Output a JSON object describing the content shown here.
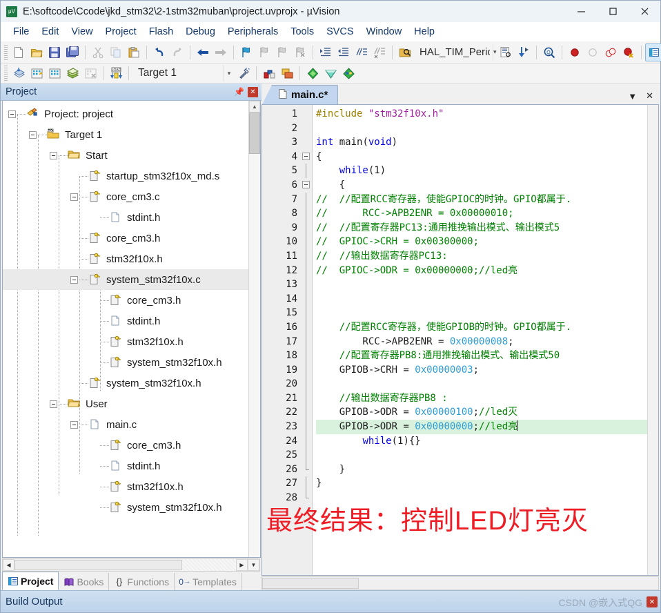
{
  "window": {
    "title": "E:\\softcode\\Ccode\\jkd_stm32\\2-1stm32muban\\project.uvprojx - µVision",
    "app_icon": "uvision-icon",
    "minimize": "—",
    "maximize": "☐",
    "close": "✕"
  },
  "menu": {
    "items": [
      {
        "label": "File"
      },
      {
        "label": "Edit"
      },
      {
        "label": "View"
      },
      {
        "label": "Project"
      },
      {
        "label": "Flash"
      },
      {
        "label": "Debug"
      },
      {
        "label": "Peripherals"
      },
      {
        "label": "Tools"
      },
      {
        "label": "SVCS"
      },
      {
        "label": "Window"
      },
      {
        "label": "Help"
      }
    ]
  },
  "toolbar2": {
    "target_value": "Target 1",
    "function_value": "HAL_TIM_PeriodE"
  },
  "project_panel": {
    "title": "Project",
    "pin_tooltip": "Auto Hide",
    "close_tooltip": "Close",
    "tree": [
      {
        "label": "Project: project",
        "depth": 0,
        "icon": "project-icon",
        "expander": "minus",
        "selected": false
      },
      {
        "label": "Target 1",
        "depth": 1,
        "icon": "target-icon",
        "expander": "minus",
        "selected": false
      },
      {
        "label": "Start",
        "depth": 2,
        "icon": "folder-icon",
        "expander": "minus",
        "selected": false
      },
      {
        "label": "startup_stm32f10x_md.s",
        "depth": 3,
        "icon": "source-file-icon",
        "expander": "none",
        "selected": false
      },
      {
        "label": "core_cm3.c",
        "depth": 3,
        "icon": "source-file-icon",
        "expander": "minus",
        "selected": false
      },
      {
        "label": "stdint.h",
        "depth": 4,
        "icon": "plain-file-icon",
        "expander": "none",
        "selected": false
      },
      {
        "label": "core_cm3.h",
        "depth": 3,
        "icon": "source-file-icon",
        "expander": "none",
        "selected": false
      },
      {
        "label": "stm32f10x.h",
        "depth": 3,
        "icon": "source-file-icon",
        "expander": "none",
        "selected": false
      },
      {
        "label": "system_stm32f10x.c",
        "depth": 3,
        "icon": "source-file-icon",
        "expander": "minus",
        "selected": true
      },
      {
        "label": "core_cm3.h",
        "depth": 4,
        "icon": "source-file-icon",
        "expander": "none",
        "selected": false
      },
      {
        "label": "stdint.h",
        "depth": 4,
        "icon": "plain-file-icon",
        "expander": "none",
        "selected": false
      },
      {
        "label": "stm32f10x.h",
        "depth": 4,
        "icon": "source-file-icon",
        "expander": "none",
        "selected": false
      },
      {
        "label": "system_stm32f10x.h",
        "depth": 4,
        "icon": "source-file-icon",
        "expander": "none",
        "selected": false
      },
      {
        "label": "system_stm32f10x.h",
        "depth": 3,
        "icon": "source-file-icon",
        "expander": "none",
        "selected": false
      },
      {
        "label": "User",
        "depth": 2,
        "icon": "folder-icon",
        "expander": "minus",
        "selected": false
      },
      {
        "label": "main.c",
        "depth": 3,
        "icon": "plain-file-icon",
        "expander": "minus",
        "selected": false
      },
      {
        "label": "core_cm3.h",
        "depth": 4,
        "icon": "source-file-icon",
        "expander": "none",
        "selected": false
      },
      {
        "label": "stdint.h",
        "depth": 4,
        "icon": "plain-file-icon",
        "expander": "none",
        "selected": false
      },
      {
        "label": "stm32f10x.h",
        "depth": 4,
        "icon": "source-file-icon",
        "expander": "none",
        "selected": false
      },
      {
        "label": "system_stm32f10x.h",
        "depth": 4,
        "icon": "source-file-icon",
        "expander": "none",
        "selected": false
      }
    ],
    "bottom_tabs": [
      {
        "label": "Project",
        "icon": "project-tab-icon",
        "active": true
      },
      {
        "label": "Books",
        "icon": "books-tab-icon",
        "active": false
      },
      {
        "label": "Functions",
        "icon": "functions-tab-icon",
        "active": false
      },
      {
        "label": "Templates",
        "icon": "templates-tab-icon",
        "active": false
      }
    ]
  },
  "editor": {
    "tab_label": "main.c*",
    "tab_icon": "file-icon",
    "dropdown_icon": "▼",
    "close_icon": "✕",
    "first_line": 1,
    "last_line": 28,
    "highlight_line": 23,
    "lines": [
      {
        "n": 1,
        "fold": "none",
        "tokens": [
          {
            "t": "#include ",
            "c": "pre"
          },
          {
            "t": "\"stm32f10x.h\"",
            "c": "str"
          }
        ]
      },
      {
        "n": 2,
        "fold": "none",
        "tokens": []
      },
      {
        "n": 3,
        "fold": "none",
        "tokens": [
          {
            "t": "int",
            "c": "kw"
          },
          {
            "t": " main(",
            "c": "plain"
          },
          {
            "t": "void",
            "c": "kw"
          },
          {
            "t": ")",
            "c": "plain"
          }
        ]
      },
      {
        "n": 4,
        "fold": "open",
        "tokens": [
          {
            "t": "{",
            "c": "plain"
          }
        ]
      },
      {
        "n": 5,
        "fold": "bar",
        "tokens": [
          {
            "t": "    ",
            "c": "plain"
          },
          {
            "t": "while",
            "c": "kw"
          },
          {
            "t": "(1)",
            "c": "plain"
          }
        ]
      },
      {
        "n": 6,
        "fold": "open2",
        "tokens": [
          {
            "t": "    {",
            "c": "plain"
          }
        ]
      },
      {
        "n": 7,
        "fold": "bar",
        "tokens": [
          {
            "t": "//  //配置RCC寄存器，使能GPIOC的时钟。GPIO都属于.",
            "c": "cmt"
          }
        ]
      },
      {
        "n": 8,
        "fold": "bar",
        "tokens": [
          {
            "t": "//      RCC->APB2ENR = 0x00000010;",
            "c": "cmt"
          }
        ]
      },
      {
        "n": 9,
        "fold": "bar",
        "tokens": [
          {
            "t": "//  //配置寄存器PC13:通用推挽输出模式、输出模式5",
            "c": "cmt"
          }
        ]
      },
      {
        "n": 10,
        "fold": "bar",
        "tokens": [
          {
            "t": "//  GPIOC->CRH = 0x00300000;",
            "c": "cmt"
          }
        ]
      },
      {
        "n": 11,
        "fold": "bar",
        "tokens": [
          {
            "t": "//  //输出数据寄存器PC13:",
            "c": "cmt"
          }
        ]
      },
      {
        "n": 12,
        "fold": "bar",
        "tokens": [
          {
            "t": "//  GPIOC->ODR = 0x00000000;//led亮",
            "c": "cmt"
          }
        ]
      },
      {
        "n": 13,
        "fold": "bar",
        "tokens": []
      },
      {
        "n": 14,
        "fold": "bar",
        "tokens": []
      },
      {
        "n": 15,
        "fold": "bar",
        "tokens": []
      },
      {
        "n": 16,
        "fold": "bar",
        "tokens": [
          {
            "t": "    //配置RCC寄存器，使能GPIOB的时钟。GPIO都属于.",
            "c": "cmt"
          }
        ]
      },
      {
        "n": 17,
        "fold": "bar",
        "tokens": [
          {
            "t": "        RCC->APB2ENR = ",
            "c": "plain"
          },
          {
            "t": "0x00000008",
            "c": "num"
          },
          {
            "t": ";",
            "c": "plain"
          }
        ]
      },
      {
        "n": 18,
        "fold": "bar",
        "tokens": [
          {
            "t": "    //配置寄存器PB8:通用推挽输出模式、输出模式50",
            "c": "cmt"
          }
        ]
      },
      {
        "n": 19,
        "fold": "bar",
        "tokens": [
          {
            "t": "    GPIOB->CRH = ",
            "c": "plain"
          },
          {
            "t": "0x00000003",
            "c": "num"
          },
          {
            "t": ";",
            "c": "plain"
          }
        ]
      },
      {
        "n": 20,
        "fold": "bar",
        "tokens": []
      },
      {
        "n": 21,
        "fold": "bar",
        "tokens": [
          {
            "t": "    //输出数据寄存器PB8 :",
            "c": "cmt"
          }
        ]
      },
      {
        "n": 22,
        "fold": "bar",
        "tokens": [
          {
            "t": "    GPIOB->ODR = ",
            "c": "plain"
          },
          {
            "t": "0x00000100",
            "c": "num"
          },
          {
            "t": ";",
            "c": "plain"
          },
          {
            "t": "//led灭",
            "c": "cmt"
          }
        ]
      },
      {
        "n": 23,
        "fold": "bar",
        "tokens": [
          {
            "t": "    GPIOB->ODR = ",
            "c": "plain"
          },
          {
            "t": "0x00000000",
            "c": "num"
          },
          {
            "t": ";",
            "c": "plain"
          },
          {
            "t": "//led亮",
            "c": "cmt"
          }
        ],
        "caret": true
      },
      {
        "n": 24,
        "fold": "bar",
        "tokens": [
          {
            "t": "        ",
            "c": "plain"
          },
          {
            "t": "while",
            "c": "kw"
          },
          {
            "t": "(1){}",
            "c": "plain"
          }
        ]
      },
      {
        "n": 25,
        "fold": "bar",
        "tokens": []
      },
      {
        "n": 26,
        "fold": "close2",
        "tokens": [
          {
            "t": "    }",
            "c": "plain"
          }
        ]
      },
      {
        "n": 27,
        "fold": "bar",
        "tokens": [
          {
            "t": "}",
            "c": "plain"
          }
        ]
      },
      {
        "n": 28,
        "fold": "close",
        "tokens": []
      }
    ]
  },
  "annotation": {
    "text": "最终结果：控制LED灯亮灭",
    "color": "#ee1c25"
  },
  "status": {
    "build_output_label": "Build Output",
    "watermark": "CSDN @嵌入式QG",
    "watermark_close": "✕"
  }
}
